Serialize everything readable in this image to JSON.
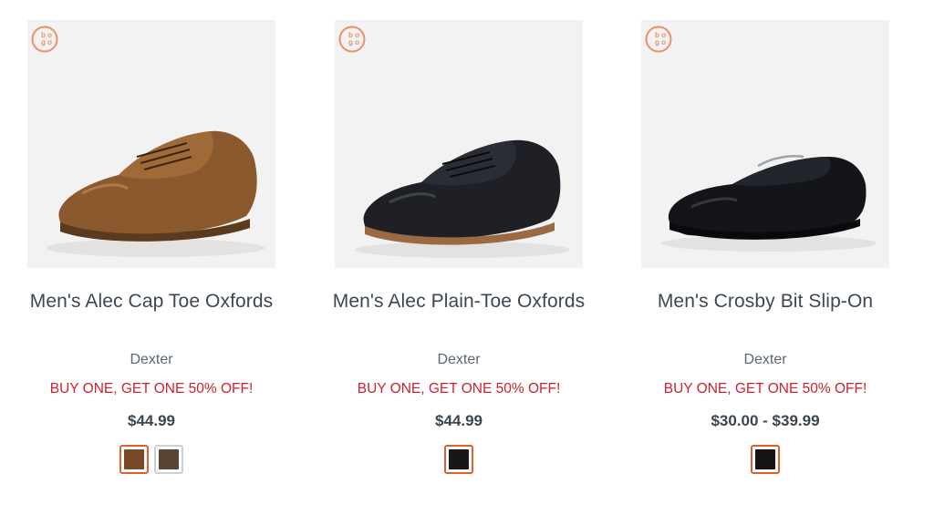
{
  "products": [
    {
      "name": "Men's Alec Cap Toe Oxfords",
      "brand": "Dexter",
      "promo": "BUY ONE, GET ONE 50% OFF!",
      "price": "$44.99",
      "badge": "bogo",
      "shoe_color": "#8a5a2e",
      "swatches": [
        {
          "color": "#7a4a28",
          "selected": true
        },
        {
          "color": "#5a4334",
          "selected": false
        }
      ]
    },
    {
      "name": "Men's Alec Plain-Toe Oxfords",
      "brand": "Dexter",
      "promo": "BUY ONE, GET ONE 50% OFF!",
      "price": "$44.99",
      "badge": "bogo",
      "shoe_color": "#1e2026",
      "swatches": [
        {
          "color": "#161719",
          "selected": true
        }
      ]
    },
    {
      "name": "Men's Crosby Bit Slip-On",
      "brand": "Dexter",
      "promo": "BUY ONE, GET ONE 50% OFF!",
      "price": "$30.00 - $39.99",
      "badge": "bogo",
      "shoe_color": "#14151a",
      "swatches": [
        {
          "color": "#151518",
          "selected": true
        }
      ]
    }
  ],
  "colors": {
    "accent": "#e0612a",
    "promo": "#d0202e",
    "text": "#3d4753",
    "image_bg": "#f3f2f2"
  }
}
